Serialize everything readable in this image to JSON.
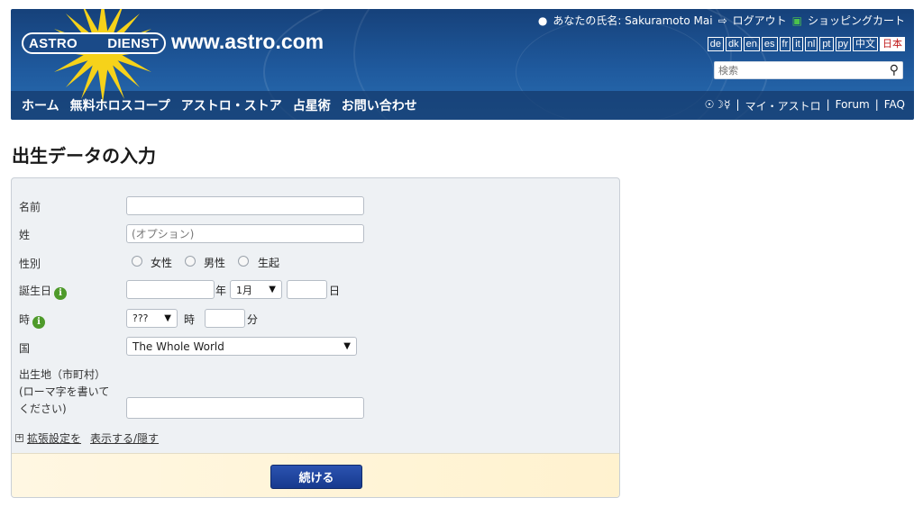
{
  "header": {
    "logo_left": "ASTRO",
    "logo_right": "DIENST",
    "site_url": "www.astro.com",
    "user_label": "あなたの氏名: Sakuramoto Mai",
    "logout_label": "ログアウト",
    "cart_label": "ショッピングカート",
    "languages": [
      "de",
      "dk",
      "en",
      "es",
      "fr",
      "it",
      "nl",
      "pt",
      "ру",
      "中文",
      "日本"
    ],
    "search_placeholder": "検索",
    "nav": [
      "ホーム",
      "無料ホロスコープ",
      "アストロ・ストア",
      "占星術",
      "お問い合わせ"
    ],
    "nav_right": {
      "symbols": "☉☽☿",
      "my_astro": "マイ・アストロ",
      "forum": "Forum",
      "faq": "FAQ",
      "sep": "|"
    }
  },
  "page": {
    "title": "出生データの入力"
  },
  "form": {
    "name_label": "名前",
    "surname_label": "姓",
    "surname_placeholder": "(オプション)",
    "gender_label": "性別",
    "gender_options": [
      "女性",
      "男性",
      "生起"
    ],
    "birthday_label": "誕生日",
    "year_unit": "年",
    "month_value": "1月",
    "day_unit": "日",
    "time_label": "時",
    "hour_value": "???",
    "hour_unit": "時",
    "minute_unit": "分",
    "country_label": "国",
    "country_value": "The Whole World",
    "birthplace_label_1": "出生地（市町村）",
    "birthplace_label_2": "(ローマ字を書いて",
    "birthplace_label_3": "ください)",
    "advanced_prefix": "拡張設定を",
    "advanced_link": "表示する/隠す",
    "submit_label": "続ける"
  },
  "colors": {
    "header_blue": "#1f5a9e",
    "button_blue": "#173a8e",
    "info_green": "#4e9a2a",
    "active_lang_red": "#c01b1b"
  }
}
